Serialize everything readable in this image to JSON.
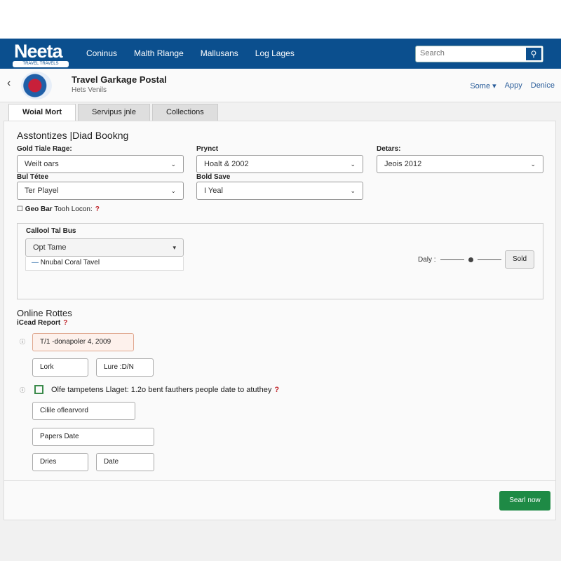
{
  "nav": {
    "logo": "Neeta",
    "logo_tag": "TRAVEL TRAVELS",
    "links": [
      "Coninus",
      "Malth Rlange",
      "Mallusans",
      "Log Lages"
    ],
    "search_placeholder": "Search"
  },
  "header": {
    "title": "Travel Garkage Postal",
    "subtitle": "Hets Venils",
    "actions": [
      "Some ▾",
      "Appy",
      "Denice"
    ]
  },
  "tabs": [
    "Woial Mort",
    "Servipus jnle",
    "Collections"
  ],
  "form": {
    "title": "Asstontizes |Diad Bookng",
    "fields": [
      {
        "label": "Gold Tiale Rage:",
        "value": "Weilt oars"
      },
      {
        "label": "Prynct",
        "value": "Hoalt & 2002"
      },
      {
        "label": "Detars:",
        "value": "Jeois 2012"
      },
      {
        "label": "Bul Tétee",
        "value": "Ter Playel"
      },
      {
        "label": "Bold Save",
        "value": "I Yeal"
      }
    ],
    "checkbox_bold": "Geo Bar",
    "checkbox_text": "Tooh Locon:",
    "help": "?",
    "box": {
      "label": "Callool Tal Bus",
      "select": "Opt Tame",
      "option": "Nnubal Coral Tavel",
      "slider_label": "Daly :",
      "button": "Sold"
    }
  },
  "online": {
    "title": "Online Rottes",
    "subtitle": "iCead Report",
    "help": "?",
    "highlight": "T/1 -donapoler 4, 2009",
    "row1": [
      "Lork",
      "Lure :D/N"
    ],
    "check_text": "Olfe tampetens Llaget: 1.2o bent fauthers people date to atuthey",
    "field1": "Cilile oflearvord",
    "field2": "Papers Date",
    "row2": [
      "Dries",
      "Date"
    ]
  },
  "submit": "Searl now",
  "colors": {
    "nav": "#0b4f8e",
    "submit": "#1e8a45",
    "help": "#c0262c"
  }
}
